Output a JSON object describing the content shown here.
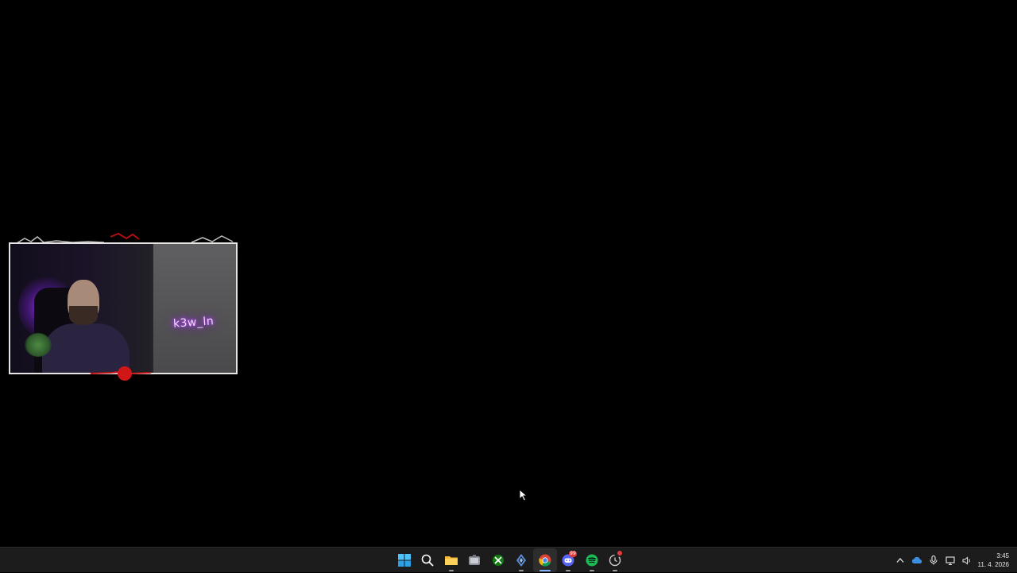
{
  "overlay": {
    "neon_text": "k3w_ln"
  },
  "taskbar": {
    "apps": [
      {
        "name": "start-button",
        "icon": "windows-logo-icon",
        "running": false
      },
      {
        "name": "search-button",
        "icon": "search-icon",
        "running": false
      },
      {
        "name": "file-explorer-button",
        "icon": "folder-icon",
        "running": true
      },
      {
        "name": "app-button",
        "icon": "toolbox-icon",
        "running": false
      },
      {
        "name": "xbox-button",
        "icon": "xbox-icon",
        "running": false
      },
      {
        "name": "app-button-2",
        "icon": "diamond-icon",
        "running": true
      },
      {
        "name": "chrome-button",
        "icon": "chrome-icon",
        "running": true,
        "active": true
      },
      {
        "name": "discord-button",
        "icon": "discord-icon",
        "running": true,
        "badge": "99"
      },
      {
        "name": "spotify-button",
        "icon": "spotify-icon",
        "running": true
      },
      {
        "name": "app-button-3",
        "icon": "clock-icon",
        "running": true,
        "notification": true
      }
    ],
    "tray": {
      "icons": [
        "chevron-up-icon",
        "onedrive-icon",
        "microphone-icon",
        "network-icon",
        "volume-icon"
      ]
    },
    "clock": {
      "time": "3:45",
      "date": "11. 4. 2026"
    }
  },
  "colors": {
    "desktop": "#000000",
    "taskbar": "#1c1c1c",
    "accent": "#7fb4ff",
    "neon": "#c24bff"
  }
}
